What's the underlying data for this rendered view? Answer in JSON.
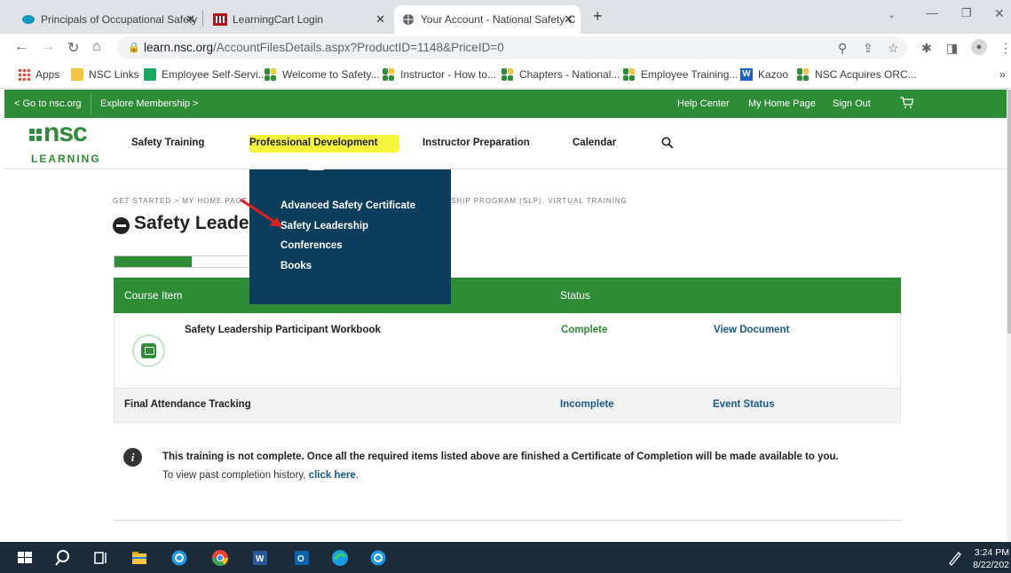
{
  "browser": {
    "tabs": [
      {
        "title": "Principals of Occupational Safety",
        "active": false
      },
      {
        "title": "LearningCart Login",
        "active": false
      },
      {
        "title": "Your Account - National Safety C",
        "active": true
      }
    ],
    "url_domain": "learn.nsc.org",
    "url_path": "/AccountFilesDetails.aspx?ProductID=1148&PriceID=0",
    "bookmarks": [
      "Apps",
      "NSC Links",
      "Employee Self-Servi...",
      "Welcome to Safety...",
      "Instructor - How to...",
      "Chapters - National...",
      "Employee Training...",
      "Kazoo",
      "NSC Acquires ORC..."
    ],
    "more_bookmarks": "»"
  },
  "topbar": {
    "go_to": "< Go to nsc.org",
    "explore": "Explore Membership >",
    "help": "Help Center",
    "home": "My Home Page",
    "signout": "Sign Out"
  },
  "logo": {
    "top": "nsc",
    "bottom": "LEARNING"
  },
  "nav": {
    "items": [
      "Safety Training",
      "Professional Development",
      "Instructor Preparation",
      "Calendar"
    ]
  },
  "dropdown": {
    "items": [
      "Advanced Safety Certificate",
      "Safety Leadership",
      "Conferences",
      "Books"
    ]
  },
  "breadcrumb": {
    "left": "GET STARTED > MY HOME PAGE",
    "right": "SHIP PROGRAM (SLP), VIRTUAL TRAINING"
  },
  "page": {
    "title": "Safety Leade",
    "progress": 0.57
  },
  "table": {
    "headers": {
      "item": "Course Item",
      "status": "Status"
    },
    "rows": [
      {
        "item": "Safety Leadership Participant Workbook",
        "status": "Complete",
        "action": "View Document"
      },
      {
        "item": "Final Attendance Tracking",
        "status": "Incomplete",
        "action": "Event Status"
      }
    ]
  },
  "info": {
    "icon": "i",
    "message": "This training is not complete. Once all the required items listed above are finished a Certificate of Completion will be made available to you.",
    "history_prefix": "To view past completion history, ",
    "history_link": "click here",
    "history_suffix": "."
  },
  "taskbar": {
    "time": "3:24 PM",
    "date": "8/22/202"
  },
  "colors": {
    "brand_green": "#2e8b36",
    "dropdown_bg": "#0d3d5c",
    "highlight": "#f5f53d",
    "link_blue": "#1a5a8a"
  }
}
